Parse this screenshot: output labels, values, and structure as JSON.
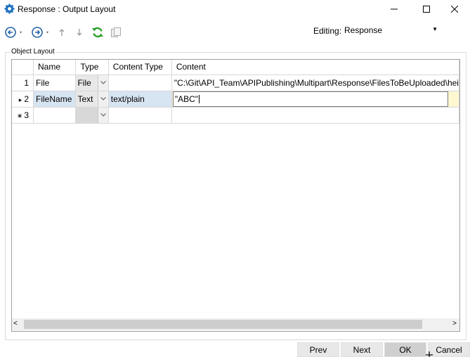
{
  "window": {
    "title": "Response : Output Layout"
  },
  "toolbar": {
    "editing_label": "Editing:",
    "editing_value": "Response",
    "buttons": [
      "back-icon",
      "forward-icon",
      "move-up-icon",
      "move-down-icon",
      "refresh-icon",
      "copy-icon"
    ]
  },
  "group": {
    "label": "Object Layout"
  },
  "table": {
    "columns": [
      "Name",
      "Type",
      "Content Type",
      "Content"
    ],
    "rows": [
      {
        "marker": "",
        "num": "1",
        "name": "File",
        "type": "File",
        "content_type": "",
        "content": "\"C:\\Git\\API_Team\\APIPublishing\\Multipart\\Response\\FilesToBeUploaded\\hei"
      },
      {
        "marker": "▸",
        "num": "2",
        "name": "FileName",
        "type": "Text",
        "content_type": "text/plain",
        "content": "\"ABC\""
      },
      {
        "marker": "∗",
        "num": "3",
        "name": "",
        "type": "",
        "content_type": "",
        "content": ""
      }
    ]
  },
  "buttons": {
    "prev": "Prev",
    "next": "Next",
    "ok": "OK",
    "cancel": "Cancel"
  }
}
